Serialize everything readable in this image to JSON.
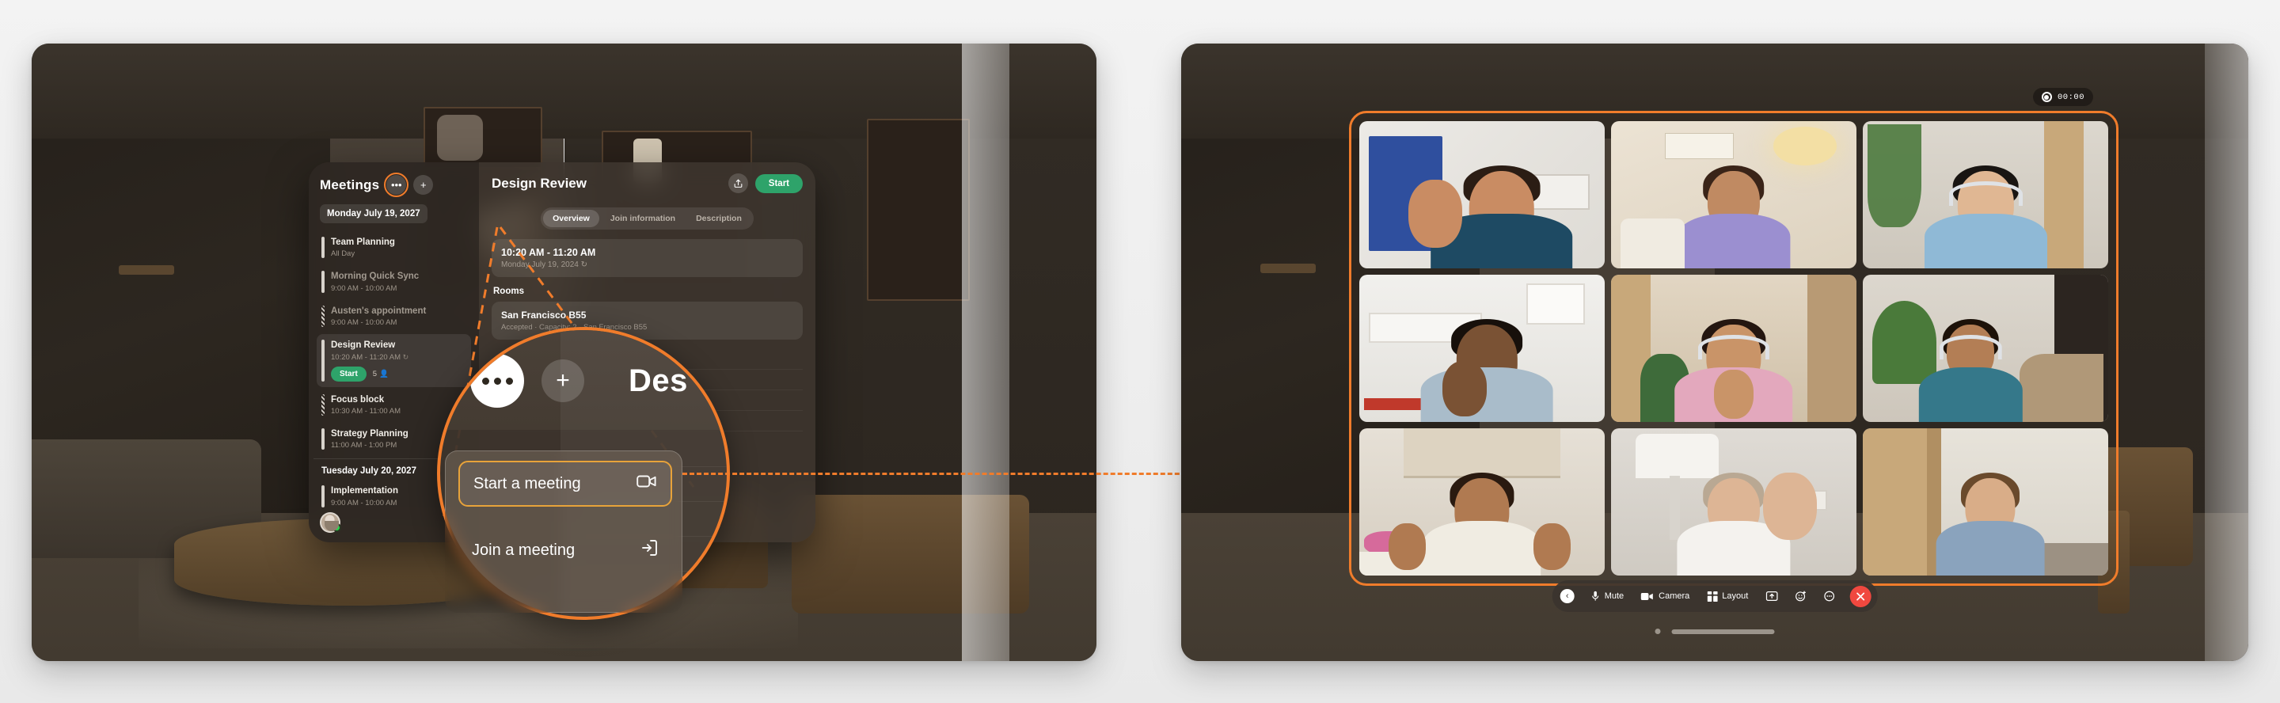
{
  "meta": {
    "accent_orange": "#f07c2b",
    "accent_green": "#2ea36a",
    "accent_red": "#f0483f",
    "page_bg": "#f1f1f1"
  },
  "left_device": {
    "app": {
      "sidebar": {
        "title": "Meetings",
        "more_icon": "ellipsis-icon",
        "add_icon": "plus-icon",
        "date_header": "Monday July 19, 2027",
        "meetings": [
          {
            "title": "Team Planning",
            "time": "All Day",
            "state": "normal",
            "bar": "solid",
            "selected": false
          },
          {
            "title": "Morning Quick Sync",
            "time": "9:00 AM - 10:00 AM",
            "state": "dim",
            "bar": "solid",
            "selected": false
          },
          {
            "title": "Austen's appointment",
            "time": "9:00 AM - 10:00 AM",
            "state": "dim",
            "bar": "hatch",
            "selected": false
          },
          {
            "title": "Design Review",
            "time": "10:20 AM - 11:20 AM",
            "state": "normal",
            "bar": "solid",
            "selected": true,
            "recurring": true,
            "start_label": "Start",
            "attendees": "5"
          },
          {
            "title": "Focus block",
            "time": "10:30 AM - 11:00 AM",
            "state": "normal",
            "bar": "hatch",
            "selected": false
          },
          {
            "title": "Strategy Planning",
            "time": "11:00 AM - 1:00 PM",
            "state": "normal",
            "bar": "solid",
            "selected": false
          }
        ],
        "day_separator": "Tuesday July 20, 2027",
        "meetings_next": [
          {
            "title": "Implementation",
            "time": "9:00 AM - 10:00 AM",
            "state": "normal",
            "bar": "solid"
          }
        ],
        "avatar_name": "user-avatar",
        "presence": "online"
      },
      "detail": {
        "title": "Design Review",
        "share_icon": "share-icon",
        "start_label": "Start",
        "tabs": [
          {
            "label": "Overview",
            "active": true
          },
          {
            "label": "Join information",
            "active": false
          },
          {
            "label": "Description",
            "active": false
          }
        ],
        "when": {
          "time_range": "10:20 AM - 11:20 AM",
          "date": "Monday July 19, 2024",
          "recurring_icon": "repeat-icon"
        },
        "rooms_heading": "Rooms",
        "rooms": [
          {
            "name": "San Francisco B55",
            "meta": "Accepted · Capacity: 2 · San Francisco B55"
          }
        ]
      }
    },
    "callout": {
      "more_icon": "ellipsis-icon",
      "add_icon": "plus-icon",
      "title_fragment": "Des",
      "menu": [
        {
          "label": "Start a meeting",
          "icon": "video-camera-icon",
          "highlighted": true
        },
        {
          "label": "Join a meeting",
          "icon": "enter-door-icon",
          "highlighted": false
        }
      ]
    }
  },
  "right_device": {
    "timer": {
      "record_icon": "record-icon",
      "value": "00:00"
    },
    "grid": {
      "rows": 3,
      "cols": 3,
      "participants": [
        {
          "id": "p1",
          "name": "participant-1",
          "gesture": "waving",
          "skin": "#c98c63",
          "hair": "#2b1d14",
          "shirt": "#1e4a63",
          "bg": "#e6e3df",
          "accent": "#2f4f9e"
        },
        {
          "id": "p2",
          "name": "participant-2",
          "gesture": "sitting",
          "skin": "#c08a62",
          "hair": "#3a2418",
          "shirt": "#9b8fd0",
          "bg": "#e8e0d2",
          "accent": "#f0d98a"
        },
        {
          "id": "p3",
          "name": "participant-3",
          "gesture": "headset",
          "skin": "#e0b793",
          "hair": "#191512",
          "shirt": "#8fb9d6",
          "bg": "#d9d4cb",
          "accent": "#4c7a3e"
        },
        {
          "id": "p4",
          "name": "participant-4",
          "gesture": "thumbsup",
          "skin": "#7a5234",
          "hair": "#17100b",
          "shirt": "#a9bcca",
          "bg": "#ecebe8",
          "accent": "#c0392b"
        },
        {
          "id": "p5",
          "name": "participant-5",
          "gesture": "clapping",
          "skin": "#c99468",
          "hair": "#241610",
          "shirt": "#e3a8bd",
          "bg": "#ddd2c1",
          "accent": "#3e6b3a"
        },
        {
          "id": "p6",
          "name": "participant-6",
          "gesture": "headset",
          "skin": "#b37e55",
          "hair": "#1d1209",
          "shirt": "#35788a",
          "bg": "#d7d2c9",
          "accent": "#4a7a3a"
        },
        {
          "id": "p7",
          "name": "participant-7",
          "gesture": "talking",
          "skin": "#b07a51",
          "hair": "#2a1a10",
          "shirt": "#f0ece2",
          "bg": "#e2dcd2",
          "accent": "#c2a06a"
        },
        {
          "id": "p8",
          "name": "participant-8",
          "gesture": "waving",
          "skin": "#ddb595",
          "hair": "#b9a893",
          "shirt": "#f4f2ee",
          "bg": "#dcd8d2",
          "accent": "#a8a29a"
        },
        {
          "id": "p9",
          "name": "participant-9",
          "gesture": "standing",
          "skin": "#d9ad88",
          "hair": "#6a4a2c",
          "shirt": "#8aa3bd",
          "bg": "#e5e1d9",
          "accent": "#c8a87a"
        }
      ]
    },
    "toolbar": {
      "back_icon": "chevron-left-icon",
      "items": [
        {
          "label": "Mute",
          "icon": "microphone-icon"
        },
        {
          "label": "Camera",
          "icon": "camera-icon"
        },
        {
          "label": "Layout",
          "icon": "layout-grid-icon"
        }
      ],
      "icon_only": [
        {
          "icon": "share-screen-icon"
        },
        {
          "icon": "reactions-icon"
        },
        {
          "icon": "more-icon"
        }
      ],
      "end_call_icon": "end-call-icon"
    },
    "home_indicator": "home-indicator"
  }
}
